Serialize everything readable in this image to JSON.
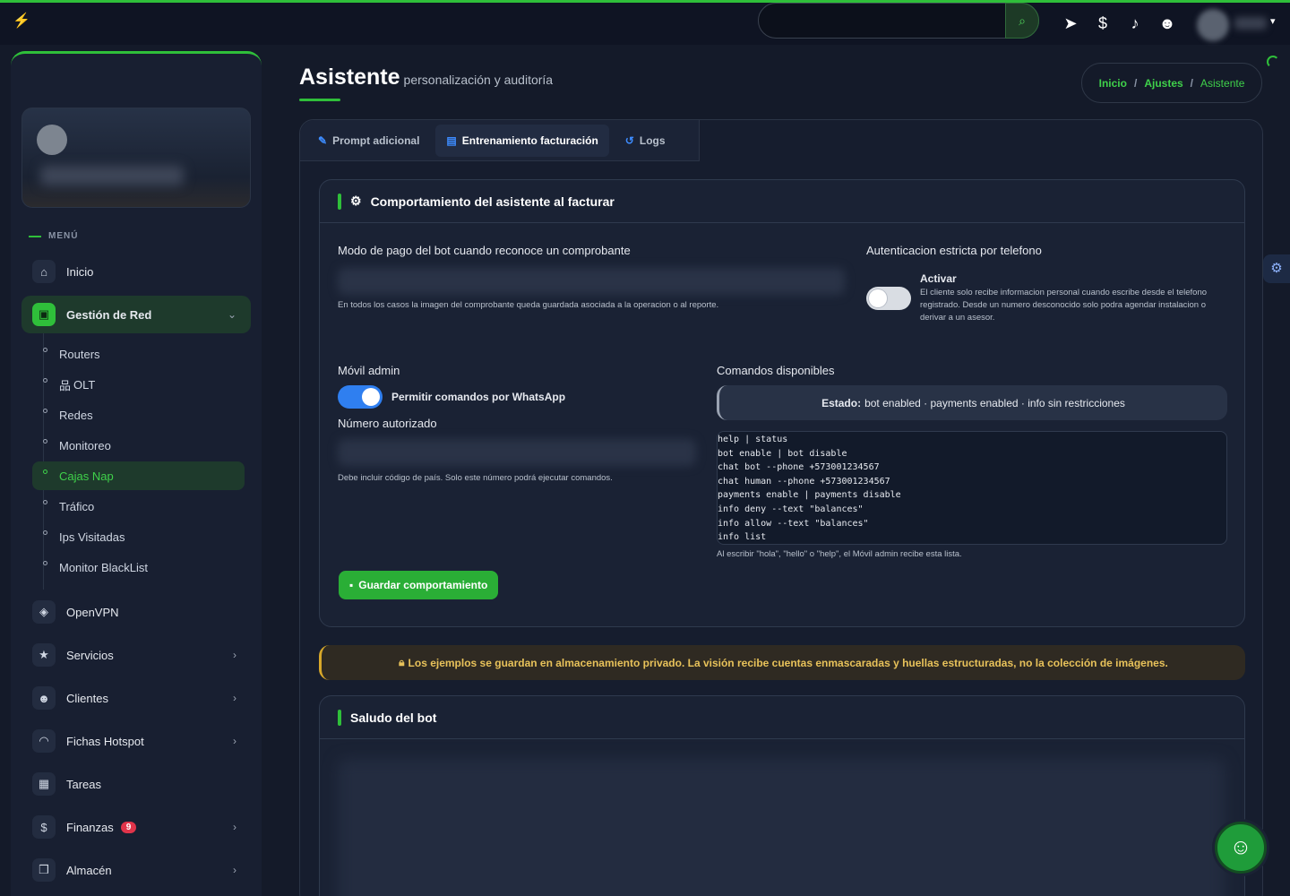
{
  "header": {
    "search_placeholder": "",
    "icons": [
      "telegram-icon",
      "dollar-icon",
      "bell-icon",
      "user-gear-icon"
    ]
  },
  "sidebar": {
    "menu_label": "MENÚ",
    "items": [
      {
        "label": "Inicio",
        "icon": "home-icon"
      },
      {
        "label": "Gestión de Red",
        "icon": "network-icon",
        "active": true
      },
      {
        "label": "OpenVPN",
        "icon": "shield-icon"
      },
      {
        "label": "Servicios",
        "icon": "star-icon"
      },
      {
        "label": "Clientes",
        "icon": "users-icon"
      },
      {
        "label": "Fichas Hotspot",
        "icon": "wifi-icon"
      },
      {
        "label": "Tareas",
        "icon": "calendar-icon"
      },
      {
        "label": "Finanzas",
        "icon": "hand-dollar-icon",
        "badge": "9"
      },
      {
        "label": "Almacén",
        "icon": "boxes-icon"
      }
    ],
    "subitems": [
      "Routers",
      "OLT",
      "Redes",
      "Monitoreo",
      "Cajas Nap",
      "Tráfico",
      "Ips Visitadas",
      "Monitor BlackList"
    ],
    "active_subitem": "Cajas Nap"
  },
  "page": {
    "title": "Asistente",
    "subtitle": "personalización y auditoría",
    "breadcrumb": [
      "Inicio",
      "Ajustes",
      "Asistente"
    ]
  },
  "tabs": [
    {
      "label": "Prompt adicional",
      "icon": "magic-wand-icon"
    },
    {
      "label": "Entrenamiento facturación",
      "icon": "document-icon",
      "active": true
    },
    {
      "label": "Logs",
      "icon": "history-icon"
    }
  ],
  "behavior_card": {
    "title": "Comportamiento del asistente al facturar",
    "payment_mode_label": "Modo de pago del bot cuando reconoce un comprobante",
    "payment_mode_help": "En todos los casos la imagen del comprobante queda guardada asociada a la operacion o al reporte.",
    "strict_auth_label": "Autenticacion estricta por telefono",
    "strict_auth_toggle_label": "Activar",
    "strict_auth_help": "El cliente solo recibe informacion personal cuando escribe desde el telefono registrado. Desde un numero desconocido solo podra agendar instalacion o derivar a un asesor.",
    "strict_auth_enabled": false,
    "mobile_admin_label": "Móvil admin",
    "whatsapp_toggle_label": "Permitir comandos por WhatsApp",
    "whatsapp_enabled": true,
    "authorized_number_label": "Número autorizado",
    "authorized_number_help": "Debe incluir código de país. Solo este número podrá ejecutar comandos.",
    "commands_label": "Comandos disponibles",
    "status_prefix": "Estado:",
    "status_text": "bot enabled · payments enabled · info sin restricciones",
    "commands": [
      "help | status",
      "bot enable | bot disable",
      "chat bot --phone +573001234567",
      "chat human --phone +573001234567",
      "payments enable | payments disable",
      "info deny --text \"balances\"",
      "info allow --text \"balances\"",
      "info list"
    ],
    "commands_help": "Al escribir \"hola\", \"hello\" o \"help\", el Móvil admin recibe esta lista.",
    "save_label": "Guardar comportamiento"
  },
  "alert": {
    "text": "Los ejemplos se guardan en almacenamiento privado. La visión recibe cuentas enmascaradas y huellas estructuradas, no la colección de imágenes."
  },
  "greeting_card": {
    "title": "Saludo del bot"
  },
  "colors": {
    "accent": "#2fbf3a",
    "toggle_on": "#2f7ff0",
    "badge": "#e0344a",
    "alert_text": "#e8c25a"
  }
}
